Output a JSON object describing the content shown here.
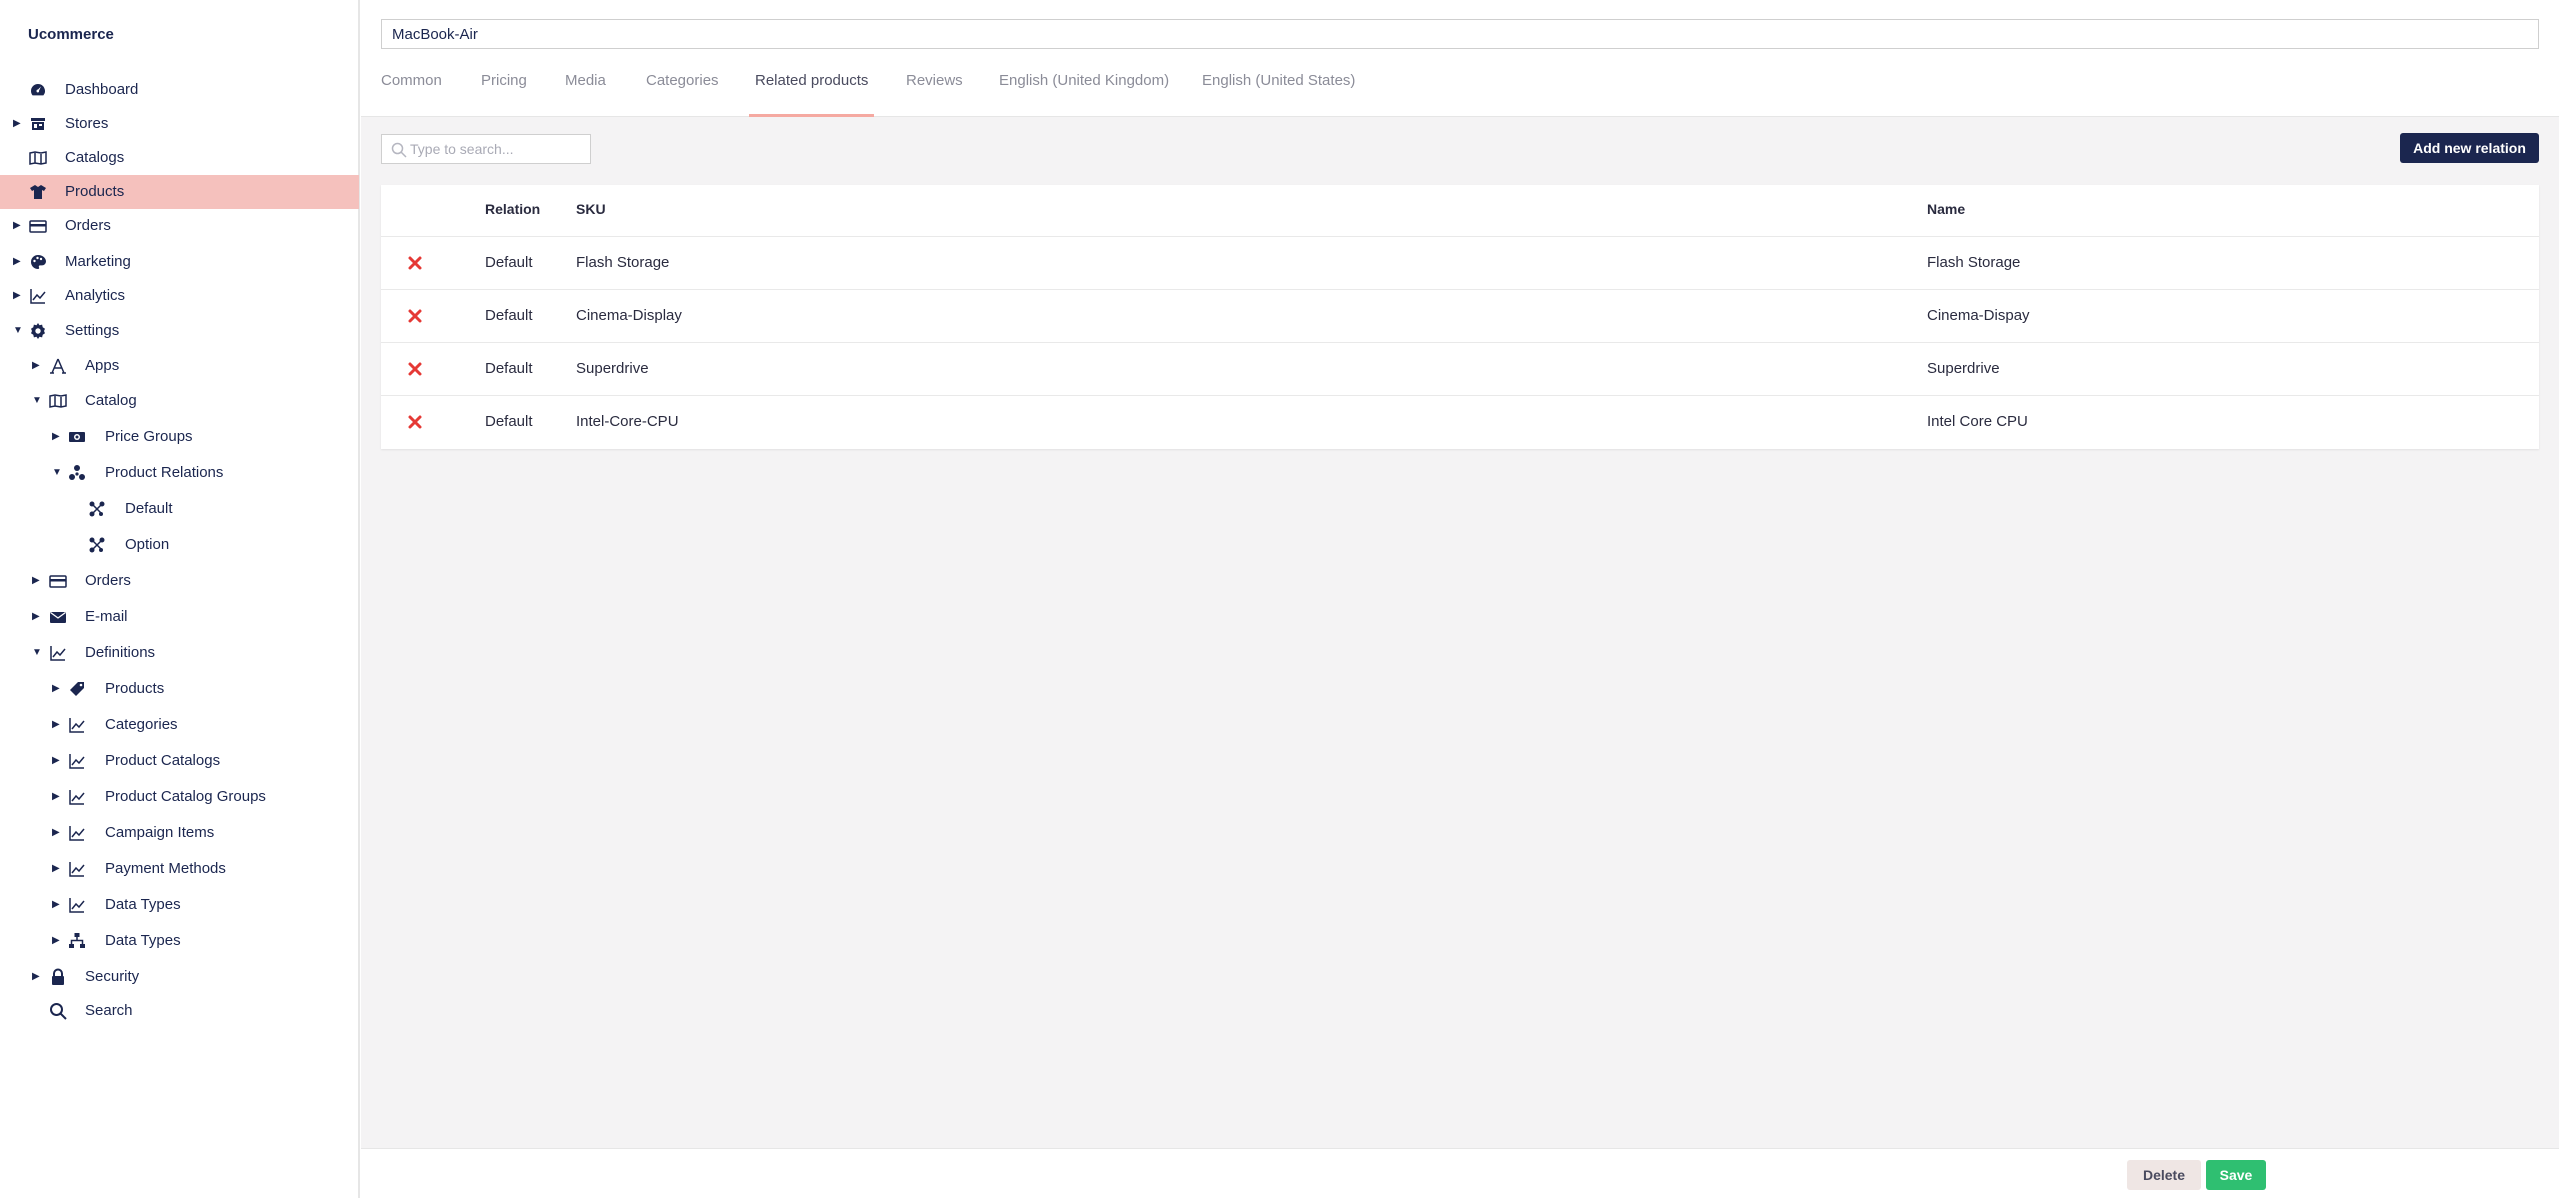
{
  "app": {
    "brand": "Ucommerce"
  },
  "sidebar": {
    "items": [
      {
        "label": "Dashboard",
        "icon": "dashboard-icon"
      },
      {
        "label": "Stores",
        "icon": "store-icon"
      },
      {
        "label": "Catalogs",
        "icon": "catalog-icon"
      },
      {
        "label": "Products",
        "icon": "product-shirt-icon"
      },
      {
        "label": "Orders",
        "icon": "credit-card-icon"
      },
      {
        "label": "Marketing",
        "icon": "palette-icon"
      },
      {
        "label": "Analytics",
        "icon": "chart-icon"
      },
      {
        "label": "Settings",
        "icon": "gear-icon"
      },
      {
        "label": "Apps",
        "icon": "apps-icon"
      },
      {
        "label": "Catalog",
        "icon": "catalog-icon"
      },
      {
        "label": "Price Groups",
        "icon": "money-icon"
      },
      {
        "label": "Product Relations",
        "icon": "relations-icon"
      },
      {
        "label": "Default",
        "icon": "relation-icon"
      },
      {
        "label": "Option",
        "icon": "relation-icon"
      },
      {
        "label": "Orders",
        "icon": "credit-card-icon"
      },
      {
        "label": "E-mail",
        "icon": "envelope-icon"
      },
      {
        "label": "Definitions",
        "icon": "chart-icon"
      },
      {
        "label": "Products",
        "icon": "tag-icon"
      },
      {
        "label": "Categories",
        "icon": "chart-icon"
      },
      {
        "label": "Product Catalogs",
        "icon": "chart-icon"
      },
      {
        "label": "Product Catalog Groups",
        "icon": "chart-icon"
      },
      {
        "label": "Campaign Items",
        "icon": "chart-icon"
      },
      {
        "label": "Payment Methods",
        "icon": "chart-icon"
      },
      {
        "label": "Data Types",
        "icon": "chart-icon"
      },
      {
        "label": "Data Types",
        "icon": "hierarchy-icon"
      },
      {
        "label": "Security",
        "icon": "lock-icon"
      },
      {
        "label": "Search",
        "icon": "search-icon"
      }
    ]
  },
  "product": {
    "name": "MacBook-Air"
  },
  "tabs": [
    {
      "label": "Common"
    },
    {
      "label": "Pricing"
    },
    {
      "label": "Media"
    },
    {
      "label": "Categories"
    },
    {
      "label": "Related products"
    },
    {
      "label": "Reviews"
    },
    {
      "label": "English (United Kingdom)"
    },
    {
      "label": "English (United States)"
    }
  ],
  "toolbar": {
    "search_placeholder": "Type to search...",
    "add_label": "Add new relation"
  },
  "table": {
    "headers": {
      "relation": "Relation",
      "sku": "SKU",
      "name": "Name"
    },
    "rows": [
      {
        "relation": "Default",
        "sku": "Flash Storage",
        "name": "Flash Storage"
      },
      {
        "relation": "Default",
        "sku": "Cinema-Display",
        "name": "Cinema-Dispay"
      },
      {
        "relation": "Default",
        "sku": "Superdrive",
        "name": "Superdrive"
      },
      {
        "relation": "Default",
        "sku": "Intel-Core-CPU",
        "name": "Intel Core CPU"
      }
    ]
  },
  "footer": {
    "delete_label": "Delete",
    "save_label": "Save"
  },
  "colors": {
    "navy": "#1b264f",
    "active_bg": "#f5c1bd",
    "tab_underline": "#f5a9a1",
    "save": "#2fbf71",
    "delete_x": "#e53935"
  }
}
